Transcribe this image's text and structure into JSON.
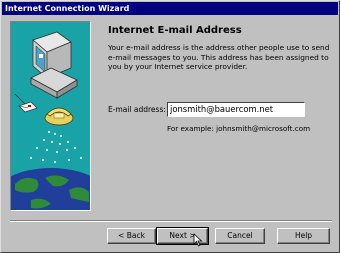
{
  "window": {
    "title": "Internet Connection Wizard"
  },
  "page": {
    "heading": "Internet E-mail Address",
    "description": "Your e-mail address is the address other people use to send e-mail messages to you. This address has been assigned to you by your Internet service provider.",
    "email_label": "E-mail address:",
    "email_value": "jonsmith@bauercom.net",
    "example": "For example: johnsmith@microsoft.com"
  },
  "buttons": {
    "back": "< Back",
    "next": "Next >",
    "cancel": "Cancel",
    "help": "Help"
  },
  "colors": {
    "titlebar": "#000080",
    "panel_teal": "#1aa3a6",
    "face": "#c0c0c0"
  },
  "icons": [
    "computer-icon",
    "telephone-icon",
    "globe-icon",
    "envelope-icon",
    "mouse-cursor-icon"
  ]
}
